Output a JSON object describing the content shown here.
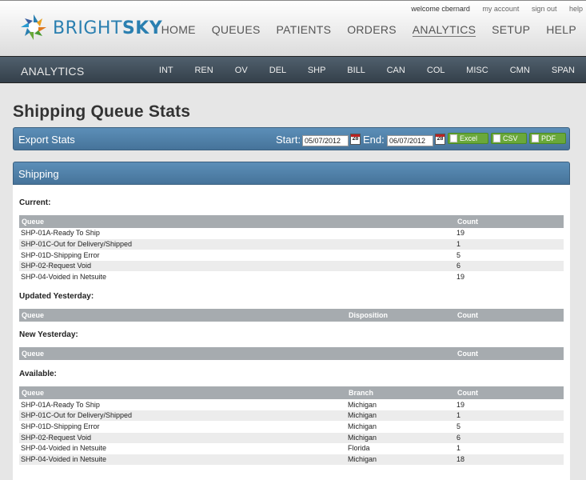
{
  "header": {
    "brand_light": "BRIGHT",
    "brand_bold": "SKY",
    "welcome": "welcome cbernard",
    "my_account": "my account",
    "sign_out": "sign out",
    "help_link": "help",
    "nav": [
      "HOME",
      "QUEUES",
      "PATIENTS",
      "ORDERS",
      "ANALYTICS",
      "SETUP",
      "HELP"
    ]
  },
  "subnav": {
    "title": "ANALYTICS",
    "items": [
      "INT",
      "REN",
      "OV",
      "DEL",
      "SHP",
      "BILL",
      "CAN",
      "COL",
      "MISC",
      "CMN",
      "SPAN"
    ]
  },
  "page": {
    "title": "Shipping Queue Stats"
  },
  "export": {
    "label": "Export Stats",
    "start_label": "Start:",
    "start_value": "05/07/2012",
    "end_label": "End:",
    "end_value": "06/07/2012",
    "cal_day": "28",
    "buttons": [
      "Excel",
      "CSV",
      "PDF"
    ]
  },
  "panel": {
    "title": "Shipping"
  },
  "current": {
    "heading": "Current:",
    "columns": [
      "Queue",
      "Count"
    ],
    "rows": [
      [
        "SHP-01A-Ready To Ship",
        "19"
      ],
      [
        "SHP-01C-Out for Delivery/Shipped",
        "1"
      ],
      [
        "SHP-01D-Shipping Error",
        "5"
      ],
      [
        "SHP-02-Request Void",
        "6"
      ],
      [
        "SHP-04-Voided in Netsuite",
        "19"
      ]
    ]
  },
  "updated": {
    "heading": "Updated Yesterday:",
    "columns": [
      "Queue",
      "Disposition",
      "Count"
    ]
  },
  "new": {
    "heading": "New Yesterday:",
    "columns": [
      "Queue",
      "Count"
    ]
  },
  "available": {
    "heading": "Available:",
    "columns": [
      "Queue",
      "Branch",
      "Count"
    ],
    "rows": [
      [
        "SHP-01A-Ready To Ship",
        "Michigan",
        "19"
      ],
      [
        "SHP-01C-Out for Delivery/Shipped",
        "Michigan",
        "1"
      ],
      [
        "SHP-01D-Shipping Error",
        "Michigan",
        "5"
      ],
      [
        "SHP-02-Request Void",
        "Michigan",
        "6"
      ],
      [
        "SHP-04-Voided in Netsuite",
        "Florida",
        "1"
      ],
      [
        "SHP-04-Voided in Netsuite",
        "Michigan",
        "18"
      ]
    ]
  }
}
